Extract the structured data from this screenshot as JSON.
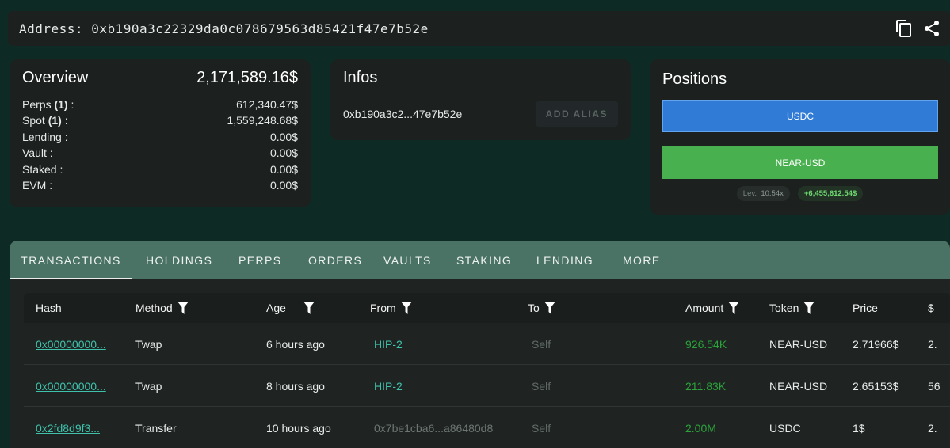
{
  "address_bar": {
    "label": "Address: 0xb190a3c22329da0c078679563d85421f47e7b52e",
    "icons": [
      "copy-icon",
      "share-icon"
    ]
  },
  "overview": {
    "title": "Overview",
    "total": "2,171,589.16$",
    "rows": [
      {
        "label": "Perps",
        "count": "(1)",
        "suffix": " :",
        "value": "612,340.47$"
      },
      {
        "label": "Spot",
        "count": "(1)",
        "suffix": " :",
        "value": "1,559,248.68$"
      },
      {
        "label": "Lending :",
        "count": "",
        "suffix": "",
        "value": "0.00$"
      },
      {
        "label": "Vault :",
        "count": "",
        "suffix": "",
        "value": "0.00$"
      },
      {
        "label": "Staked :",
        "count": "",
        "suffix": "",
        "value": "0.00$"
      },
      {
        "label": "EVM :",
        "count": "",
        "suffix": "",
        "value": "0.00$"
      }
    ]
  },
  "infos": {
    "title": "Infos",
    "short_address": "0xb190a3c2...47e7b52e",
    "alias_button": "ADD ALIAS"
  },
  "positions": {
    "title": "Positions",
    "bars": [
      "USDC",
      "NEAR-USD"
    ],
    "lev_label": "Lev.",
    "lev_value": "10.54x",
    "pnl": "+6,455,612.54$",
    "colors": {
      "usdc": "#2f7bd6",
      "near": "#48b04e"
    }
  },
  "tabs": [
    "TRANSACTIONS",
    "HOLDINGS",
    "PERPS",
    "ORDERS",
    "VAULTS",
    "STAKING",
    "LENDING",
    "MORE"
  ],
  "active_tab": "TRANSACTIONS",
  "table": {
    "headers": [
      "Hash",
      "Method",
      "Age",
      "From",
      "To",
      "Amount",
      "Token",
      "Price",
      "$"
    ],
    "rows": [
      {
        "hash": "0x00000000...",
        "method": "Twap",
        "age": "6 hours ago",
        "from": "HIP-2",
        "to": "Self",
        "amount": "926.54K",
        "token": "NEAR-USD",
        "price": "2.71966$",
        "usd": "2."
      },
      {
        "hash": "0x00000000...",
        "method": "Twap",
        "age": "8 hours ago",
        "from": "HIP-2",
        "to": "Self",
        "amount": "211.83K",
        "token": "NEAR-USD",
        "price": "2.65153$",
        "usd": "56"
      },
      {
        "hash": "0x2fd8d9f3...",
        "method": "Transfer",
        "age": "10 hours ago",
        "from": "0x7be1cba6...a86480d8",
        "to": "Self",
        "amount": "2.00M",
        "token": "USDC",
        "price": "1$",
        "usd": "2."
      }
    ]
  }
}
